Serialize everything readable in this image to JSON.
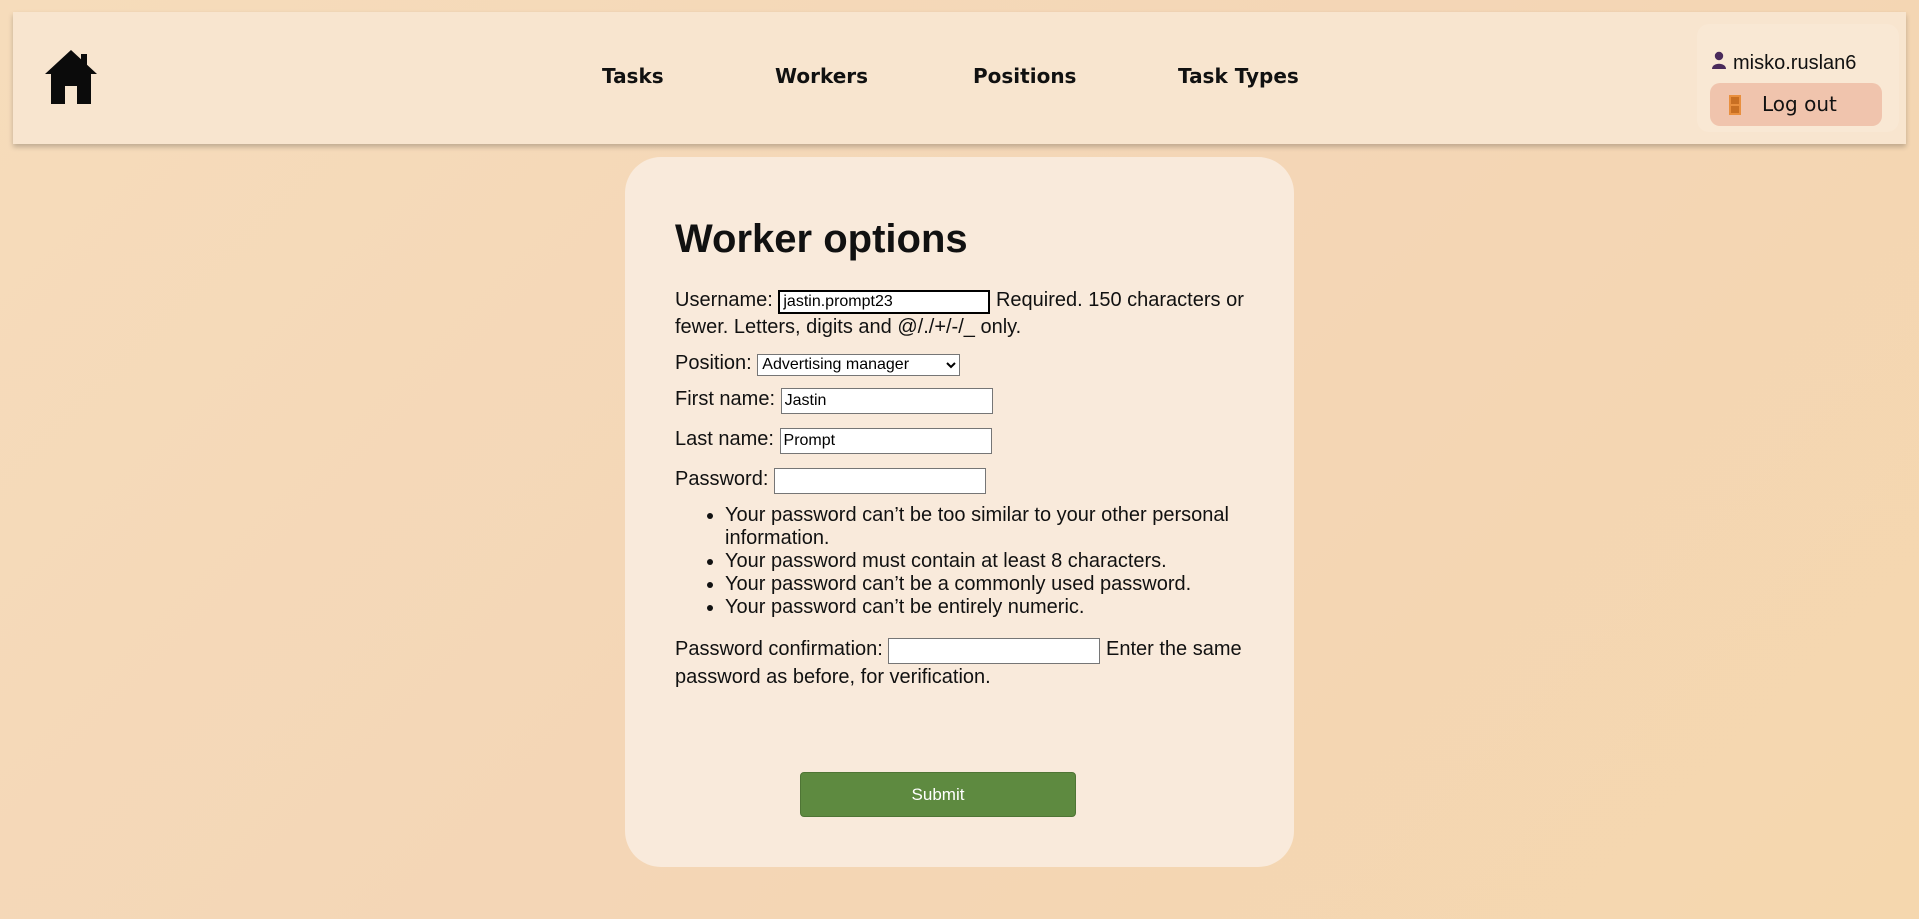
{
  "nav": {
    "home_icon": "home-icon",
    "links": [
      "Tasks",
      "Workers",
      "Positions",
      "Task Types"
    ]
  },
  "user": {
    "icon": "user-icon",
    "username": "misko.ruslan6",
    "logout_icon": "door-icon",
    "logout_label": "Log out"
  },
  "form": {
    "title": "Worker options",
    "username_label": "Username:",
    "username_value": "jastin.prompt23",
    "username_help": "Required. 150 characters or fewer. Letters, digits and @/./+/-/_ only.",
    "position_label": "Position:",
    "position_value": "Advertising manager",
    "first_name_label": "First name:",
    "first_name_value": "Jastin",
    "last_name_label": "Last name:",
    "last_name_value": "Prompt",
    "password_label": "Password:",
    "password_value": "",
    "password_help": [
      "Your password can’t be too similar to your other personal information.",
      "Your password must contain at least 8 characters.",
      "Your password can’t be a commonly used password.",
      "Your password can’t be entirely numeric."
    ],
    "password2_label": "Password confirmation:",
    "password2_value": "",
    "password2_help": "Enter the same password as before, for verification.",
    "submit_label": "Submit"
  },
  "colors": {
    "navbar_bg": "#f8e5cf",
    "card_bg": "#f9eadb",
    "logout_bg": "#f0c4ad",
    "submit_bg": "#5e8a40"
  }
}
